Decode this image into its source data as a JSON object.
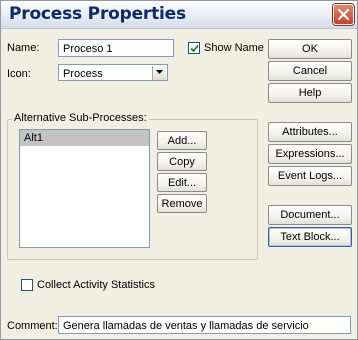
{
  "window": {
    "title": "Process Properties"
  },
  "form": {
    "name_label": "Name:",
    "name_value": "Proceso 1",
    "show_name_label": "Show Name",
    "show_name_checked": true,
    "icon_label": "Icon:",
    "icon_value": "Process",
    "alt_group_label": "Alternative Sub-Processes:",
    "alt_items": [
      "Alt1"
    ],
    "collect_stats_label": "Collect Activity Statistics",
    "collect_stats_checked": false,
    "comment_label": "Comment:",
    "comment_value": "Genera llamadas de ventas y llamadas de servicio"
  },
  "alt_buttons": {
    "add": "Add...",
    "copy": "Copy",
    "edit": "Edit...",
    "remove": "Remove"
  },
  "side_buttons": {
    "ok": "OK",
    "cancel": "Cancel",
    "help": "Help",
    "attributes": "Attributes...",
    "expressions": "Expressions...",
    "event_logs": "Event Logs...",
    "document": "Document...",
    "text_block": "Text Block..."
  },
  "icons": {
    "close": "close-icon",
    "dropdown": "chevron-down-icon",
    "check": "check-icon"
  },
  "colors": {
    "title_text": "#0b2a6b",
    "close_button": "#c8402a",
    "list_selection": "#c3c3c3",
    "dialog_bg": "#f1efe2"
  }
}
